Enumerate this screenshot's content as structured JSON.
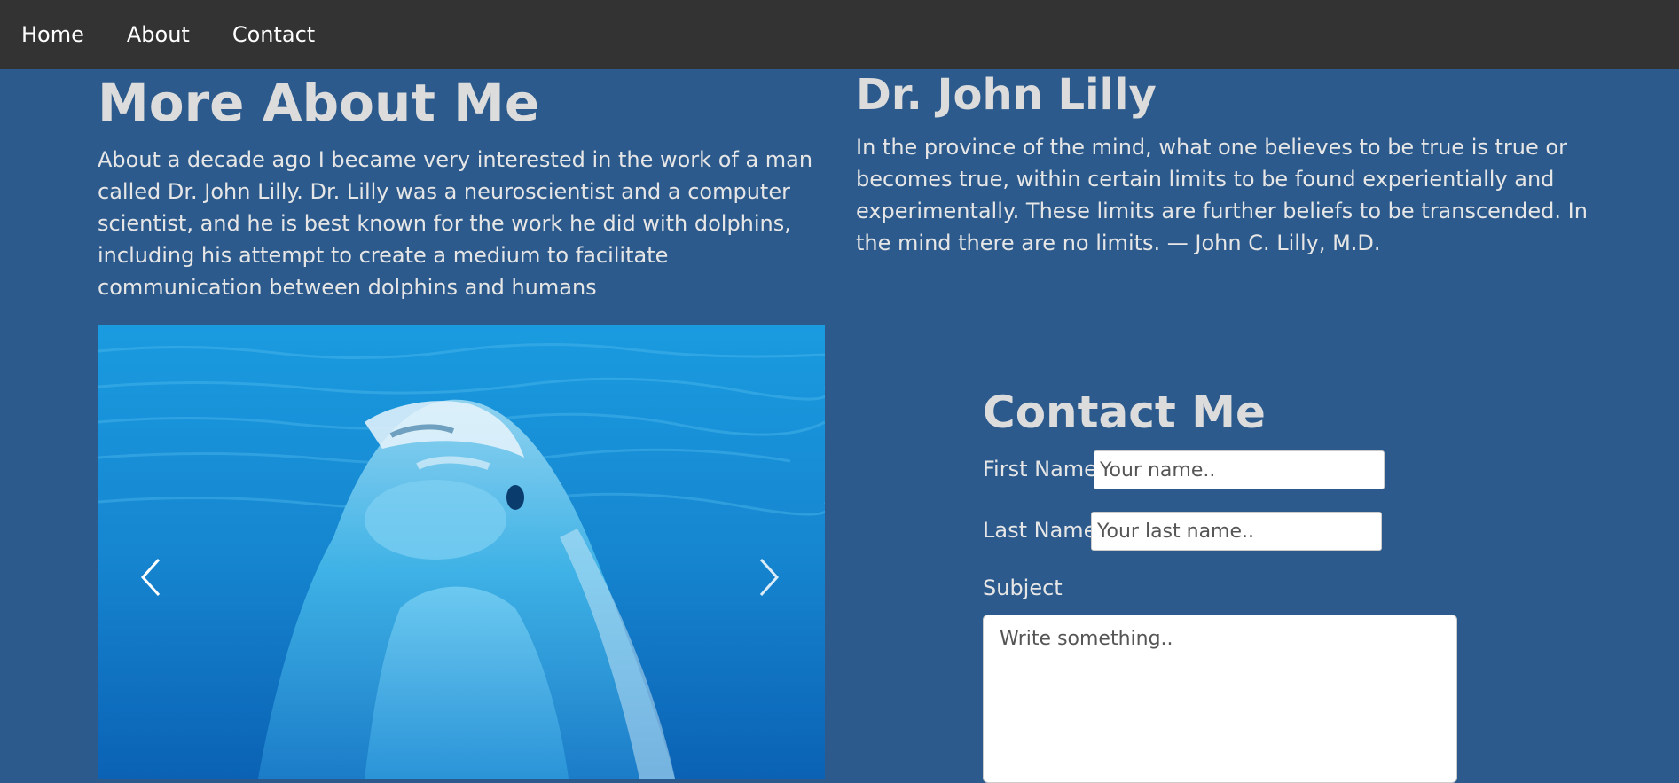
{
  "nav": {
    "items": [
      {
        "label": "Home"
      },
      {
        "label": "About"
      },
      {
        "label": "Contact"
      }
    ]
  },
  "about": {
    "title": "More About Me",
    "text": "About a decade ago I became very interested in the work of a man called Dr. John Lilly. Dr. Lilly was a neuroscientist and a computer scientist, and he is best known for the work he did with dolphins, including his attempt to create a medium to facilitate communication between dolphins and humans"
  },
  "quote": {
    "title": "Dr. John Lilly",
    "text": "In the province of the mind, what one believes to be true is true or becomes true, within certain limits to be found experientially and experimentally. These limits are further beliefs to be transcended. In the mind there are no limits. — John C. Lilly, M.D."
  },
  "carousel": {
    "prev_icon": "chevron-left-icon",
    "next_icon": "chevron-right-icon"
  },
  "contact": {
    "title": "Contact Me",
    "first_name_label": "First Name",
    "first_name_placeholder": "Your name..",
    "last_name_label": "Last Name",
    "last_name_placeholder": "Your last name..",
    "subject_label": "Subject",
    "subject_placeholder": "Write something.."
  },
  "colors": {
    "navbar": "#333333",
    "background": "#2c5a8c",
    "heading": "#dcdcdc",
    "text": "#e6e6e6"
  }
}
